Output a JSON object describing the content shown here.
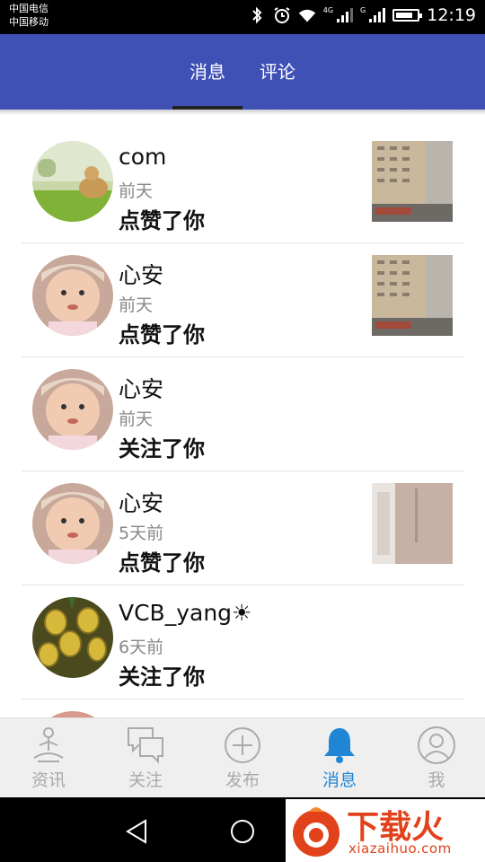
{
  "status_bar": {
    "carrier_1": "中国电信",
    "carrier_2": "中国移动",
    "network_1": "4G",
    "network_2": "G",
    "time": "12:19",
    "battery_level": 0.8,
    "icons": [
      "bluetooth-icon",
      "alarm-icon",
      "wifi-icon",
      "signal-icon",
      "signal-icon",
      "battery-icon"
    ]
  },
  "tabs": [
    {
      "label": "消息",
      "active": true
    },
    {
      "label": "评论",
      "active": false
    }
  ],
  "notifications": [
    {
      "name": "com",
      "time": "前天",
      "action": "点赞了你",
      "avatar": "dog-photo",
      "thumbnail": "building-photo"
    },
    {
      "name": "心安",
      "time": "前天",
      "action": "点赞了你",
      "avatar": "baby-photo",
      "thumbnail": "building-photo"
    },
    {
      "name": "心安",
      "time": "前天",
      "action": "关注了你",
      "avatar": "baby-photo",
      "thumbnail": null
    },
    {
      "name": "心安",
      "time": "5天前",
      "action": "点赞了你",
      "avatar": "baby-photo",
      "thumbnail": "wall-photo"
    },
    {
      "name": "VCB_yang☀",
      "time": "6天前",
      "action": "关注了你",
      "avatar": "pineapple-photo",
      "thumbnail": null
    }
  ],
  "bottom_nav": [
    {
      "label": "资讯",
      "icon": "meditation-icon",
      "active": false
    },
    {
      "label": "关注",
      "icon": "chat-bubbles-icon",
      "active": false
    },
    {
      "label": "发布",
      "icon": "plus-circle-icon",
      "active": false
    },
    {
      "label": "消息",
      "icon": "bell-icon",
      "active": true
    },
    {
      "label": "我",
      "icon": "user-icon",
      "active": false
    }
  ],
  "watermark": {
    "text": "下载火",
    "url": "xiazaihuo.com"
  },
  "colors": {
    "app_bar": "#3f51b5",
    "active_nav": "#1f86d6",
    "inactive_nav": "#aaaaaa",
    "watermark": "#e2421b"
  }
}
